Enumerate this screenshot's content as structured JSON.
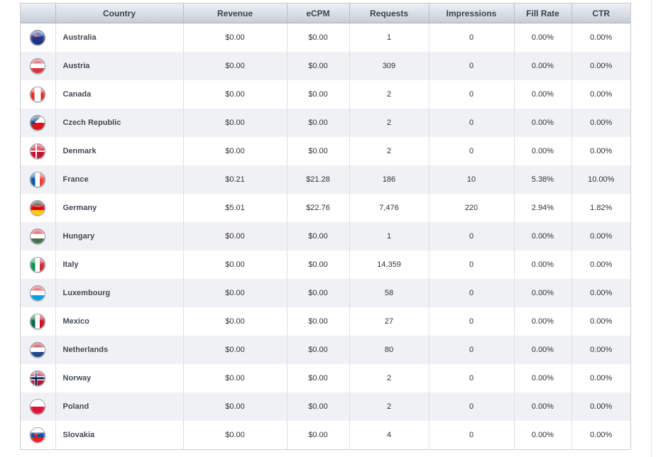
{
  "table": {
    "headers": [
      "",
      "Country",
      "Revenue",
      "eCPM",
      "Requests",
      "Impressions",
      "Fill Rate",
      "CTR"
    ],
    "rows": [
      {
        "country": "Australia",
        "flag_icon": "australia-flag-icon",
        "revenue": "$0.00",
        "ecpm": "$0.00",
        "requests": "1",
        "impressions": "0",
        "fill_rate": "0.00%",
        "ctr": "0.00%"
      },
      {
        "country": "Austria",
        "flag_icon": "austria-flag-icon",
        "revenue": "$0.00",
        "ecpm": "$0.00",
        "requests": "309",
        "impressions": "0",
        "fill_rate": "0.00%",
        "ctr": "0.00%"
      },
      {
        "country": "Canada",
        "flag_icon": "canada-flag-icon",
        "revenue": "$0.00",
        "ecpm": "$0.00",
        "requests": "2",
        "impressions": "0",
        "fill_rate": "0.00%",
        "ctr": "0.00%"
      },
      {
        "country": "Czech Republic",
        "flag_icon": "czech-republic-flag-icon",
        "revenue": "$0.00",
        "ecpm": "$0.00",
        "requests": "2",
        "impressions": "0",
        "fill_rate": "0.00%",
        "ctr": "0.00%"
      },
      {
        "country": "Denmark",
        "flag_icon": "denmark-flag-icon",
        "revenue": "$0.00",
        "ecpm": "$0.00",
        "requests": "2",
        "impressions": "0",
        "fill_rate": "0.00%",
        "ctr": "0.00%"
      },
      {
        "country": "France",
        "flag_icon": "france-flag-icon",
        "revenue": "$0.21",
        "ecpm": "$21.28",
        "requests": "186",
        "impressions": "10",
        "fill_rate": "5.38%",
        "ctr": "10.00%"
      },
      {
        "country": "Germany",
        "flag_icon": "germany-flag-icon",
        "revenue": "$5.01",
        "ecpm": "$22.76",
        "requests": "7,476",
        "impressions": "220",
        "fill_rate": "2.94%",
        "ctr": "1.82%"
      },
      {
        "country": "Hungary",
        "flag_icon": "hungary-flag-icon",
        "revenue": "$0.00",
        "ecpm": "$0.00",
        "requests": "1",
        "impressions": "0",
        "fill_rate": "0.00%",
        "ctr": "0.00%"
      },
      {
        "country": "Italy",
        "flag_icon": "italy-flag-icon",
        "revenue": "$0.00",
        "ecpm": "$0.00",
        "requests": "14,359",
        "impressions": "0",
        "fill_rate": "0.00%",
        "ctr": "0.00%"
      },
      {
        "country": "Luxembourg",
        "flag_icon": "luxembourg-flag-icon",
        "revenue": "$0.00",
        "ecpm": "$0.00",
        "requests": "58",
        "impressions": "0",
        "fill_rate": "0.00%",
        "ctr": "0.00%"
      },
      {
        "country": "Mexico",
        "flag_icon": "mexico-flag-icon",
        "revenue": "$0.00",
        "ecpm": "$0.00",
        "requests": "27",
        "impressions": "0",
        "fill_rate": "0.00%",
        "ctr": "0.00%"
      },
      {
        "country": "Netherlands",
        "flag_icon": "netherlands-flag-icon",
        "revenue": "$0.00",
        "ecpm": "$0.00",
        "requests": "80",
        "impressions": "0",
        "fill_rate": "0.00%",
        "ctr": "0.00%"
      },
      {
        "country": "Norway",
        "flag_icon": "norway-flag-icon",
        "revenue": "$0.00",
        "ecpm": "$0.00",
        "requests": "2",
        "impressions": "0",
        "fill_rate": "0.00%",
        "ctr": "0.00%"
      },
      {
        "country": "Poland",
        "flag_icon": "poland-flag-icon",
        "revenue": "$0.00",
        "ecpm": "$0.00",
        "requests": "2",
        "impressions": "0",
        "fill_rate": "0.00%",
        "ctr": "0.00%"
      },
      {
        "country": "Slovakia",
        "flag_icon": "slovakia-flag-icon",
        "revenue": "$0.00",
        "ecpm": "$0.00",
        "requests": "4",
        "impressions": "0",
        "fill_rate": "0.00%",
        "ctr": "0.00%"
      }
    ]
  },
  "flag_colors": {
    "australia-flag-icon": "radial-gradient(circle at 35% 35%, #d33 0 12%, transparent 13%), linear-gradient(#2a3f9e, #1b2d7a)",
    "austria-flag-icon": "linear-gradient(#d9333f 0 33%, #ffffff 33% 66%, #d9333f 66%)",
    "canada-flag-icon": "linear-gradient(90deg, #d52b1e 0 28%, #ffffff 28% 72%, #d52b1e 72%)",
    "czech-republic-flag-icon": "linear-gradient(135deg, #11457e 0 40%, transparent 40%), linear-gradient(#ffffff 0 50%, #d7141a 50%)",
    "denmark-flag-icon": "linear-gradient(90deg, transparent 0 34%, #ffffff 34% 46%, transparent 46%), linear-gradient(transparent 0 44%, #ffffff 44% 56%, transparent 56%), #c8102e",
    "france-flag-icon": "linear-gradient(90deg, #0055a4 0 33%, #ffffff 33% 66%, #ef4135 66%)",
    "germany-flag-icon": "linear-gradient(#222222 0 33%, #dd0000 33% 66%, #ffce00 66%)",
    "hungary-flag-icon": "linear-gradient(#ce2939 0 33%, #ffffff 33% 66%, #477050 66%)",
    "italy-flag-icon": "linear-gradient(90deg, #009246 0 33%, #ffffff 33% 66%, #ce2b37 66%)",
    "luxembourg-flag-icon": "linear-gradient(#ed2939 0 33%, #ffffff 33% 66%, #00a1de 66%)",
    "mexico-flag-icon": "linear-gradient(90deg, #006847 0 33%, #ffffff 33% 66%, #ce1126 66%)",
    "netherlands-flag-icon": "linear-gradient(#ae1c28 0 33%, #ffffff 33% 66%, #21468b 66%)",
    "norway-flag-icon": "linear-gradient(90deg, transparent 0 32%, #00205b 32% 44%, transparent 44%), linear-gradient(transparent 0 42%, #00205b 42% 58%, transparent 58%), linear-gradient(90deg, transparent 0 28%, #ffffff 28% 48%, transparent 48%), linear-gradient(transparent 0 36%, #ffffff 36% 64%, transparent 64%), #ba0c2f",
    "poland-flag-icon": "linear-gradient(#ffffff 0 50%, #dc143c 50%)",
    "slovakia-flag-icon": "radial-gradient(circle at 38% 50%, #ee1c25 0 16%, transparent 17%), linear-gradient(#ffffff 0 33%, #0b4ea2 33% 66%, #ee1c25 66%)"
  }
}
